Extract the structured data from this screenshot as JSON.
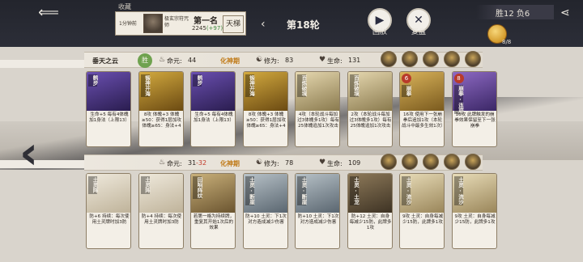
{
  "header": {
    "record": {
      "title": "收藏",
      "time": "1分钟前",
      "user": "极玄宗符咒师",
      "rank": "第一名",
      "score": "2245",
      "delta": "(+97)",
      "ladder": "天梯"
    },
    "round": "第18轮",
    "replay_label": "回放",
    "review_label": "复盘",
    "score_summary": "胜12 负6",
    "coin_count": "8/8"
  },
  "players": [
    {
      "name": "垂天之云",
      "badge": "胜",
      "mingyuan_label": "命元:",
      "mingyuan_value": "44",
      "mingyuan_extra": "",
      "realm": "化神期",
      "xiuwei_label": "修为:",
      "xiuwei_value": "83",
      "life_label": "生命:",
      "life_value": "131",
      "cards": [
        {
          "title": "鹤步",
          "text": "生命+5 每有4体魄加1身法（上限13）",
          "art": "#6a4fb0",
          "art2": "#2a1d4f",
          "badge": ""
        },
        {
          "title": "锻神开海",
          "text": "8攻 体魄+3 体魄≥50：获得1层加攻 体魄≥65：身法+4",
          "art": "#d3aa3f",
          "art2": "#6b4a12",
          "badge": ""
        },
        {
          "title": "鹤步",
          "text": "生命+5 每有4体魄加1身法（上限13）",
          "art": "#6a4fb0",
          "art2": "#2a1d4f",
          "badge": ""
        },
        {
          "title": "锻神开海",
          "text": "8攻 体魄+3 体魄≥50：获得1层加攻 体魄≥65：身法+4",
          "art": "#d3aa3f",
          "art2": "#6b4a12",
          "badge": ""
        },
        {
          "title": "百炼破境",
          "text": "4攻（本轮战斗每加过3体魄多1攻）每有25体魄追加1次攻击",
          "art": "#e6d8b0",
          "art2": "#8a7a4e",
          "badge": ""
        },
        {
          "title": "百炼破境",
          "text": "2攻（本轮战斗每加过3体魄多1攻）每有25体魄追加1次攻击",
          "art": "#e6d8b0",
          "art2": "#8a7a4e",
          "badge": ""
        },
        {
          "title": "崩拳",
          "text": "16攻 使用下一张崩拳后追加1攻（本轮战斗中最多生效1次）",
          "art": "#d9b35a",
          "art2": "#7a5a1e",
          "badge": "6"
        },
        {
          "title": "崩拳·连崩",
          "text": "16攻 此牌触发的崩拳效果保留至下一张崩拳",
          "art": "#8e6ac4",
          "art2": "#3b2766",
          "badge": "8"
        }
      ]
    },
    {
      "name": "",
      "badge": "",
      "mingyuan_label": "命元:",
      "mingyuan_value": "31",
      "mingyuan_extra": "-32",
      "realm": "化神期",
      "xiuwei_label": "修为:",
      "xiuwei_value": "78",
      "life_label": "生命:",
      "life_value": "109",
      "cards": [
        {
          "title": "土灵阵",
          "text": "防+6 持续：每次使用土灵牌时加3防",
          "art": "#efe9dc",
          "art2": "#bfb39a",
          "badge": ""
        },
        {
          "title": "土灵阵",
          "text": "防+4 持续：每次使用土灵牌时加3防",
          "art": "#efe9dc",
          "art2": "#bfb39a",
          "badge": ""
        },
        {
          "title": "回响阵纹",
          "text": "若第一格为持续牌，重复其开始1次后的效果",
          "art": "#c9b07a",
          "art2": "#6b5530",
          "badge": ""
        },
        {
          "title": "土灵·断崖",
          "text": "防+10 土灵：下1次对方造成减少伤害",
          "art": "#b8c2c8",
          "art2": "#5a6670",
          "badge": ""
        },
        {
          "title": "土灵·断崖",
          "text": "防+10 土灵：下1次对方造成减少伤害",
          "art": "#b8c2c8",
          "art2": "#5a6670",
          "badge": ""
        },
        {
          "title": "土灵·土龙",
          "text": "防+12 土灵：自身每减少15防，此牌多1攻",
          "art": "#8e7a5a",
          "art2": "#3e3324",
          "badge": ""
        },
        {
          "title": "土灵·流沙",
          "text": "9攻 土灵：自身每减少15防，此牌多1攻",
          "art": "#e8dcb8",
          "art2": "#9a865a",
          "badge": ""
        },
        {
          "title": "土灵·流沙",
          "text": "9攻 土灵：自身每减少15防，此牌多1攻",
          "art": "#e8dcb8",
          "art2": "#9a865a",
          "badge": ""
        }
      ]
    }
  ],
  "icons": {
    "back": "back-arrow-icon",
    "replay": "play-icon",
    "review": "close-icon",
    "share": "share-icon",
    "mingyuan": "flame-icon",
    "xiuwei": "cultivation-icon",
    "life": "heart-icon"
  },
  "colors": {
    "realm": "#c07a18",
    "loss": "#c23a2a",
    "win_badge": "#6fa24f"
  }
}
